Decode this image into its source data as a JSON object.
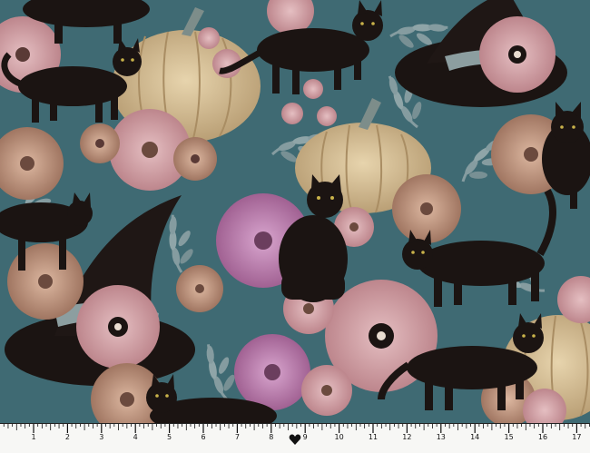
{
  "image": {
    "description_tags": [
      "black-cat-icon",
      "pumpkin-icon",
      "witch-hat-icon",
      "flower-icon",
      "ruler"
    ],
    "colors": {
      "background": "#3f6a73",
      "cat": "#1b1412",
      "pumpkin": "#d4b98e",
      "flower_pink": "#c9949a",
      "flower_magenta": "#b86fa6",
      "flower_tan": "#b78a72",
      "leaf": "#8ea2a5",
      "ruler_bg": "#f7f7f5"
    }
  },
  "ruler": {
    "labels": [
      "1",
      "2",
      "3",
      "4",
      "5",
      "6",
      "7",
      "8",
      "9",
      "10",
      "11",
      "12",
      "13",
      "14",
      "15",
      "16",
      "17"
    ],
    "marker_icon": "heart-icon"
  }
}
